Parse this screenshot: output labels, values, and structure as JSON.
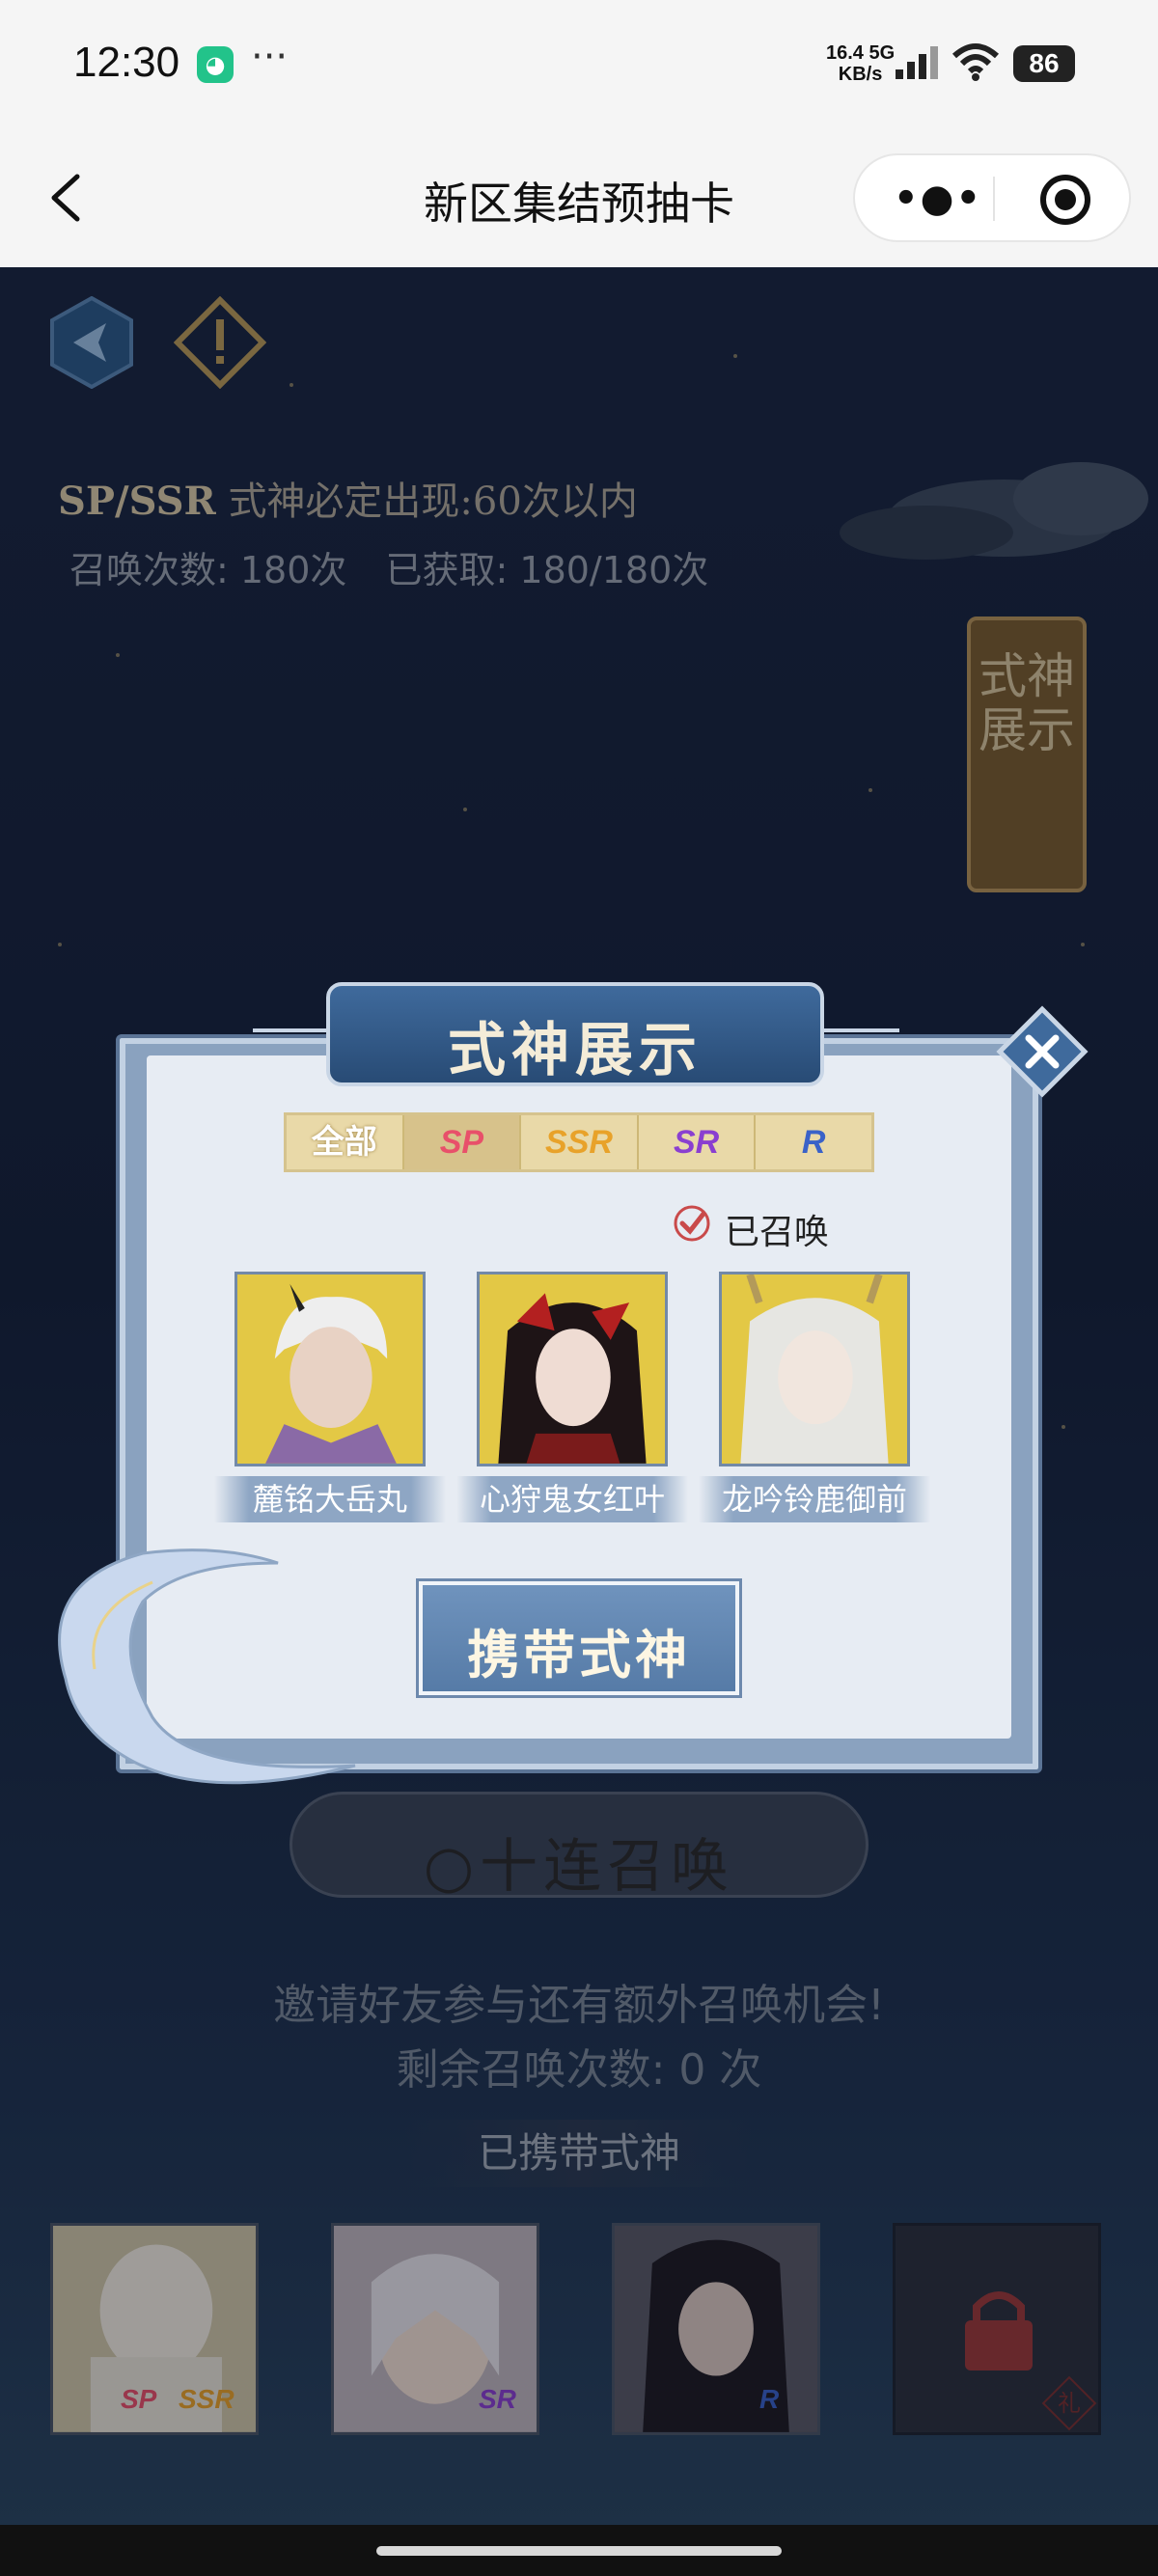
{
  "status_bar": {
    "time": "12:30",
    "app_icon": "wechat-mini-icon",
    "more": "···",
    "speed": "16.4",
    "speed_unit": "KB/s",
    "network": "5G",
    "battery": "86"
  },
  "nav": {
    "title": "新区集结预抽卡",
    "more_icon": "more-dots-icon",
    "close_icon": "target-close-icon"
  },
  "game": {
    "pity_prefix": "SP/SSR",
    "pity_text": "式神必定出现:",
    "pity_count": "60次以内",
    "summon_count": "召唤次数: 180次",
    "obtained": "已获取: 180/180次",
    "side_banner": "式神展示",
    "ten_summon": "十连召唤",
    "invite": "邀请好友参与还有额外召唤机会!",
    "remaining": "剩余召唤次数: 0 次",
    "carried_title": "已携带式神",
    "carried_slots": [
      {
        "badges": [
          "SP",
          "SSR"
        ],
        "tone": "light"
      },
      {
        "badges": [
          "SR"
        ],
        "tone": "pink"
      },
      {
        "badges": [
          "R"
        ],
        "tone": "dark"
      },
      {
        "badges": [],
        "locked": true,
        "gift": "礼"
      }
    ]
  },
  "modal": {
    "title": "式神展示",
    "tabs": [
      "全部",
      "SP",
      "SSR",
      "SR",
      "R"
    ],
    "active_tab": 1,
    "summoned_label": "已召唤",
    "cards": [
      {
        "name": "麓铭大岳丸"
      },
      {
        "name": "心狩鬼女红叶"
      },
      {
        "name": "龙吟铃鹿御前"
      }
    ],
    "carry_button": "携带式神"
  },
  "colors": {
    "sp": "#e8506a",
    "ssr": "#e8a22a",
    "sr": "#8a3fd0",
    "r": "#3a62c8",
    "card_bg": "#e3c845",
    "modal_blue": "#3f6a9c"
  }
}
